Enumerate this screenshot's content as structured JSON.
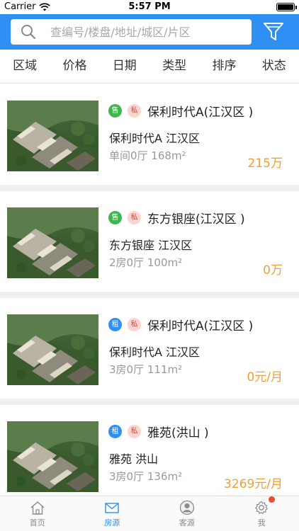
{
  "status_bar": {
    "carrier": "Carrier",
    "time": "5:57 PM"
  },
  "search": {
    "placeholder": "查编号/楼盘/地址/城区/片区",
    "value": ""
  },
  "filters": [
    "区域",
    "价格",
    "日期",
    "类型",
    "排序",
    "状态"
  ],
  "colors": {
    "brand_blue": "#2e8ff5",
    "price_orange": "#f0a033",
    "sell_green": "#3fb54f",
    "private_pink": "#fbd3cf"
  },
  "listings": [
    {
      "type_tag": "售",
      "type_icon": "sell",
      "private_tag": "私",
      "title": "保利时代A(江汉区 )",
      "subtitle": "保利时代A 江汉区",
      "detail": "单间0厅 168m²",
      "price": "215万"
    },
    {
      "type_tag": "售",
      "type_icon": "sell",
      "private_tag": "私",
      "title": "东方银座(江汉区 )",
      "subtitle": "东方银座 江汉区",
      "detail": "2房0厅 100m²",
      "price": "0万"
    },
    {
      "type_tag": "租",
      "type_icon": "rent",
      "private_tag": "私",
      "title": "保利时代A(江汉区 )",
      "subtitle": "保利时代A 江汉区",
      "detail": "3房0厅 111m²",
      "price": "0元/月"
    },
    {
      "type_tag": "租",
      "type_icon": "rent",
      "private_tag": "私",
      "title": "雅苑(洪山 )",
      "subtitle": "雅苑 洪山",
      "detail": "3房0厅 136m²",
      "price": "3269元/月"
    }
  ],
  "tab_bar": [
    {
      "label": "首页",
      "icon": "home-icon"
    },
    {
      "label": "房源",
      "icon": "mail-icon"
    },
    {
      "label": "客源",
      "icon": "user-icon"
    },
    {
      "label": "我",
      "icon": "gear-icon"
    }
  ]
}
